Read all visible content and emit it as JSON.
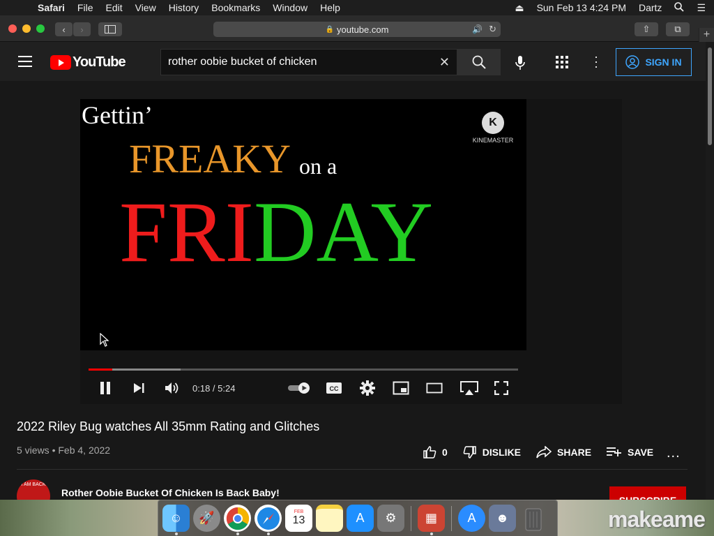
{
  "menubar": {
    "items": [
      "Safari",
      "File",
      "Edit",
      "View",
      "History",
      "Bookmarks",
      "Window",
      "Help"
    ],
    "datetime": "Sun Feb 13  4:24 PM",
    "user": "Dartz"
  },
  "browser": {
    "url": "youtube.com"
  },
  "youtube": {
    "logo_text": "YouTube",
    "search_value": "rother oobie bucket of chicken",
    "sign_in_label": "SIGN IN"
  },
  "video_frame": {
    "line1": "Gettin’",
    "line2": "FREAKY",
    "line3": "on a",
    "friday_red": "FRI",
    "friday_green": "DAY",
    "kinemaster_badge": "K",
    "kinemaster_label": "KINEMASTER"
  },
  "player": {
    "time": "0:18 / 5:24",
    "played_fraction": 0.055,
    "buffered_fraction": 0.215
  },
  "video_info": {
    "title": "2022 Riley Bug watches All 35mm Rating and Glitches",
    "meta": "5 views • Feb 4, 2022",
    "like_count": "0",
    "dislike_label": "DISLIKE",
    "share_label": "SHARE",
    "save_label": "SAVE",
    "more": "..."
  },
  "channel": {
    "name": "Rother Oobie Bucket Of Chicken Is Back Baby!",
    "avatar_text": "I AM BACK",
    "subscribe_label": "SUBSCRIBE"
  },
  "dock": {
    "icons": [
      "finder-icon",
      "launchpad-icon",
      "chrome-icon",
      "safari-icon",
      "calendar-icon",
      "notes-icon",
      "app-store-icon",
      "system-preferences-icon",
      "photo-booth-icon",
      "app-store-downloads-icon",
      "user-folder-icon",
      "trash-icon"
    ],
    "calendar_month": "FEB",
    "calendar_day": "13"
  },
  "watermark": "makeame"
}
